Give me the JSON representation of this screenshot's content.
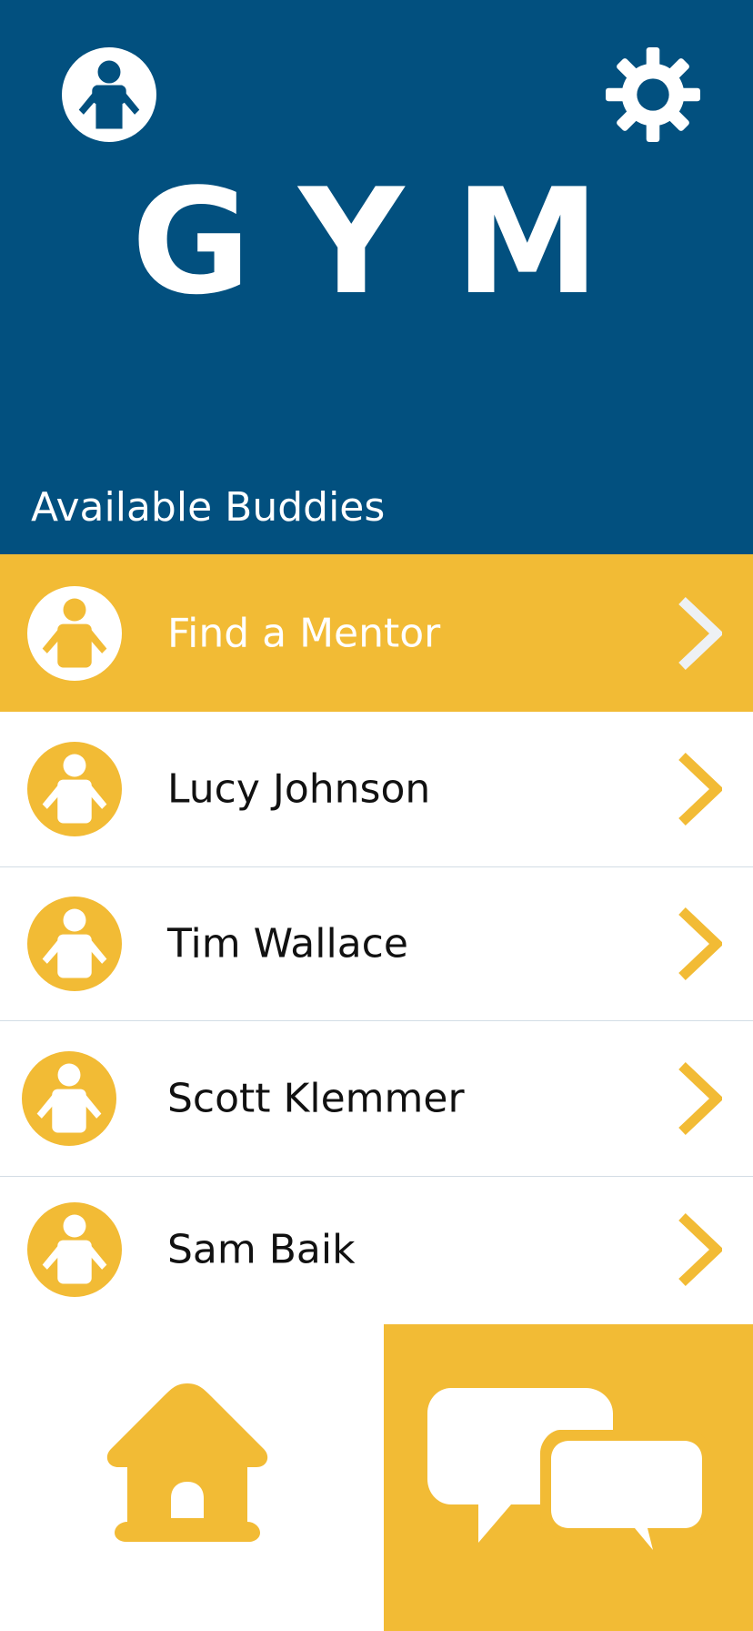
{
  "header": {
    "app_title": "GYM",
    "section_title": "Available Buddies",
    "icons": {
      "profile": "user-profile-icon",
      "settings": "gear-icon"
    }
  },
  "buddies": {
    "featured": {
      "label": "Find a Mentor",
      "icon": "person-icon"
    },
    "items": [
      {
        "name": "Lucy Johnson"
      },
      {
        "name": "Tim Wallace"
      },
      {
        "name": "Scott Klemmer"
      },
      {
        "name": "Sam Baik"
      }
    ]
  },
  "tabbar": {
    "home": {
      "icon": "home-icon",
      "active": false
    },
    "chat": {
      "icon": "chat-bubbles-icon",
      "active": true
    }
  },
  "colors": {
    "primary": "#02507f",
    "accent": "#f2bb35",
    "background": "#ffffff",
    "text": "#111111"
  }
}
